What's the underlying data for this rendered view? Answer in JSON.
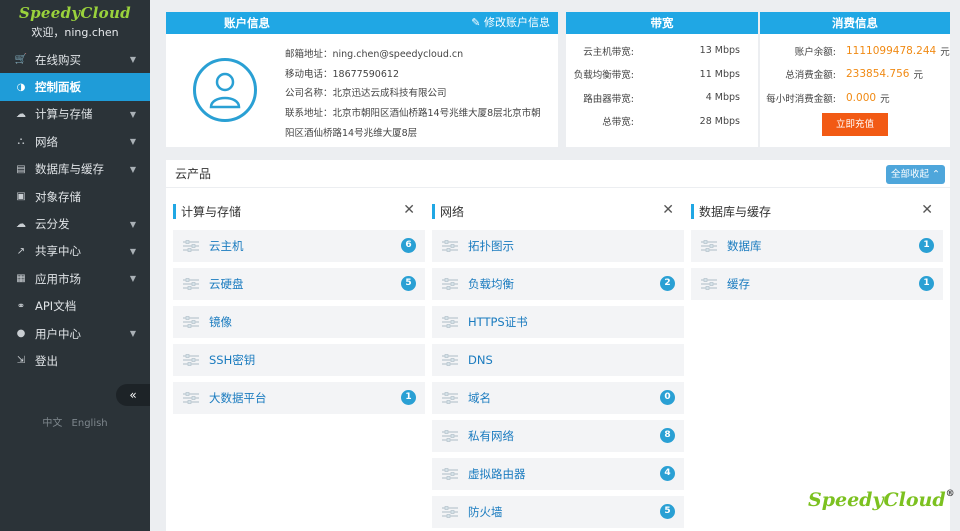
{
  "sidebar": {
    "logo": "SpeedyCloud",
    "welcome": "欢迎，ning.chen",
    "items": [
      {
        "label": "在线购买",
        "icon": "cart-icon",
        "glyph": "🛒",
        "caret": true,
        "active": false
      },
      {
        "label": "控制面板",
        "icon": "dashboard-icon",
        "glyph": "◑",
        "caret": false,
        "active": true
      },
      {
        "label": "计算与存储",
        "icon": "cloud-icon",
        "glyph": "☁",
        "caret": true,
        "active": false
      },
      {
        "label": "网络",
        "icon": "network-icon",
        "glyph": "⛬",
        "caret": true,
        "active": false
      },
      {
        "label": "数据库与缓存",
        "icon": "database-icon",
        "glyph": "▤",
        "caret": true,
        "active": false
      },
      {
        "label": "对象存储",
        "icon": "folder-icon",
        "glyph": "▣",
        "caret": false,
        "active": false
      },
      {
        "label": "云分发",
        "icon": "cloud-distribute-icon",
        "glyph": "☁",
        "caret": true,
        "active": false
      },
      {
        "label": "共享中心",
        "icon": "share-icon",
        "glyph": "↗",
        "caret": true,
        "active": false
      },
      {
        "label": "应用市场",
        "icon": "store-icon",
        "glyph": "▦",
        "caret": true,
        "active": false
      },
      {
        "label": "API文档",
        "icon": "link-icon",
        "glyph": "⚭",
        "caret": false,
        "active": false
      },
      {
        "label": "用户中心",
        "icon": "user-icon",
        "glyph": "●",
        "caret": true,
        "active": false
      },
      {
        "label": "登出",
        "icon": "logout-icon",
        "glyph": "⇲",
        "caret": false,
        "active": false
      }
    ],
    "collapse_glyph": "«",
    "lang_zh": "中文",
    "lang_en": "English"
  },
  "account": {
    "title": "账户信息",
    "edit_label": "修改账户信息",
    "email": "邮箱地址：ning.chen@speedycloud.cn",
    "phone": "移动电话：18677590612",
    "company": "公司名称：北京迅达云成科技有限公司",
    "address": "联系地址：北京市朝阳区酒仙桥路14号兆维大厦8层北京市朝阳区酒仙桥路14号兆维大厦8层"
  },
  "bandwidth": {
    "title": "带宽",
    "rows": [
      {
        "label": "云主机带宽:",
        "value": "13 Mbps"
      },
      {
        "label": "负载均衡带宽:",
        "value": "11 Mbps"
      },
      {
        "label": "路由器带宽:",
        "value": "4 Mbps"
      },
      {
        "label": "总带宽:",
        "value": "28 Mbps"
      }
    ]
  },
  "spending": {
    "title": "消费信息",
    "rows": [
      {
        "label": "账户余额:",
        "value": "1111099478.244",
        "unit": "元"
      },
      {
        "label": "总消费金额:",
        "value": "233854.756",
        "unit": "元"
      },
      {
        "label": "每小时消费金额:",
        "value": "0.000",
        "unit": "元"
      }
    ],
    "recharge_label": "立即充值"
  },
  "products": {
    "title": "云产品",
    "collapse_all": "全部收起",
    "columns": [
      {
        "title": "计算与存储",
        "items": [
          {
            "label": "云主机",
            "count": "6"
          },
          {
            "label": "云硬盘",
            "count": "5"
          },
          {
            "label": "镜像",
            "count": ""
          },
          {
            "label": "SSH密钥",
            "count": ""
          },
          {
            "label": "大数据平台",
            "count": "1"
          }
        ]
      },
      {
        "title": "网络",
        "items": [
          {
            "label": "拓扑图示",
            "count": ""
          },
          {
            "label": "负载均衡",
            "count": "2"
          },
          {
            "label": "HTTPS证书",
            "count": ""
          },
          {
            "label": "DNS",
            "count": ""
          },
          {
            "label": "域名",
            "count": "0"
          },
          {
            "label": "私有网络",
            "count": "8"
          },
          {
            "label": "虚拟路由器",
            "count": "4"
          },
          {
            "label": "防火墙",
            "count": "5"
          }
        ]
      },
      {
        "title": "数据库与缓存",
        "items": [
          {
            "label": "数据库",
            "count": "1"
          },
          {
            "label": "缓存",
            "count": "1"
          }
        ]
      }
    ]
  },
  "brand": {
    "name": "SpeedyCloud",
    "reg": "®"
  },
  "colors": {
    "accent": "#20a7e4",
    "sidebar": "#2b3338",
    "orange": "#f08a14",
    "recharge": "#f25a14",
    "brand_green": "#7cc120"
  }
}
